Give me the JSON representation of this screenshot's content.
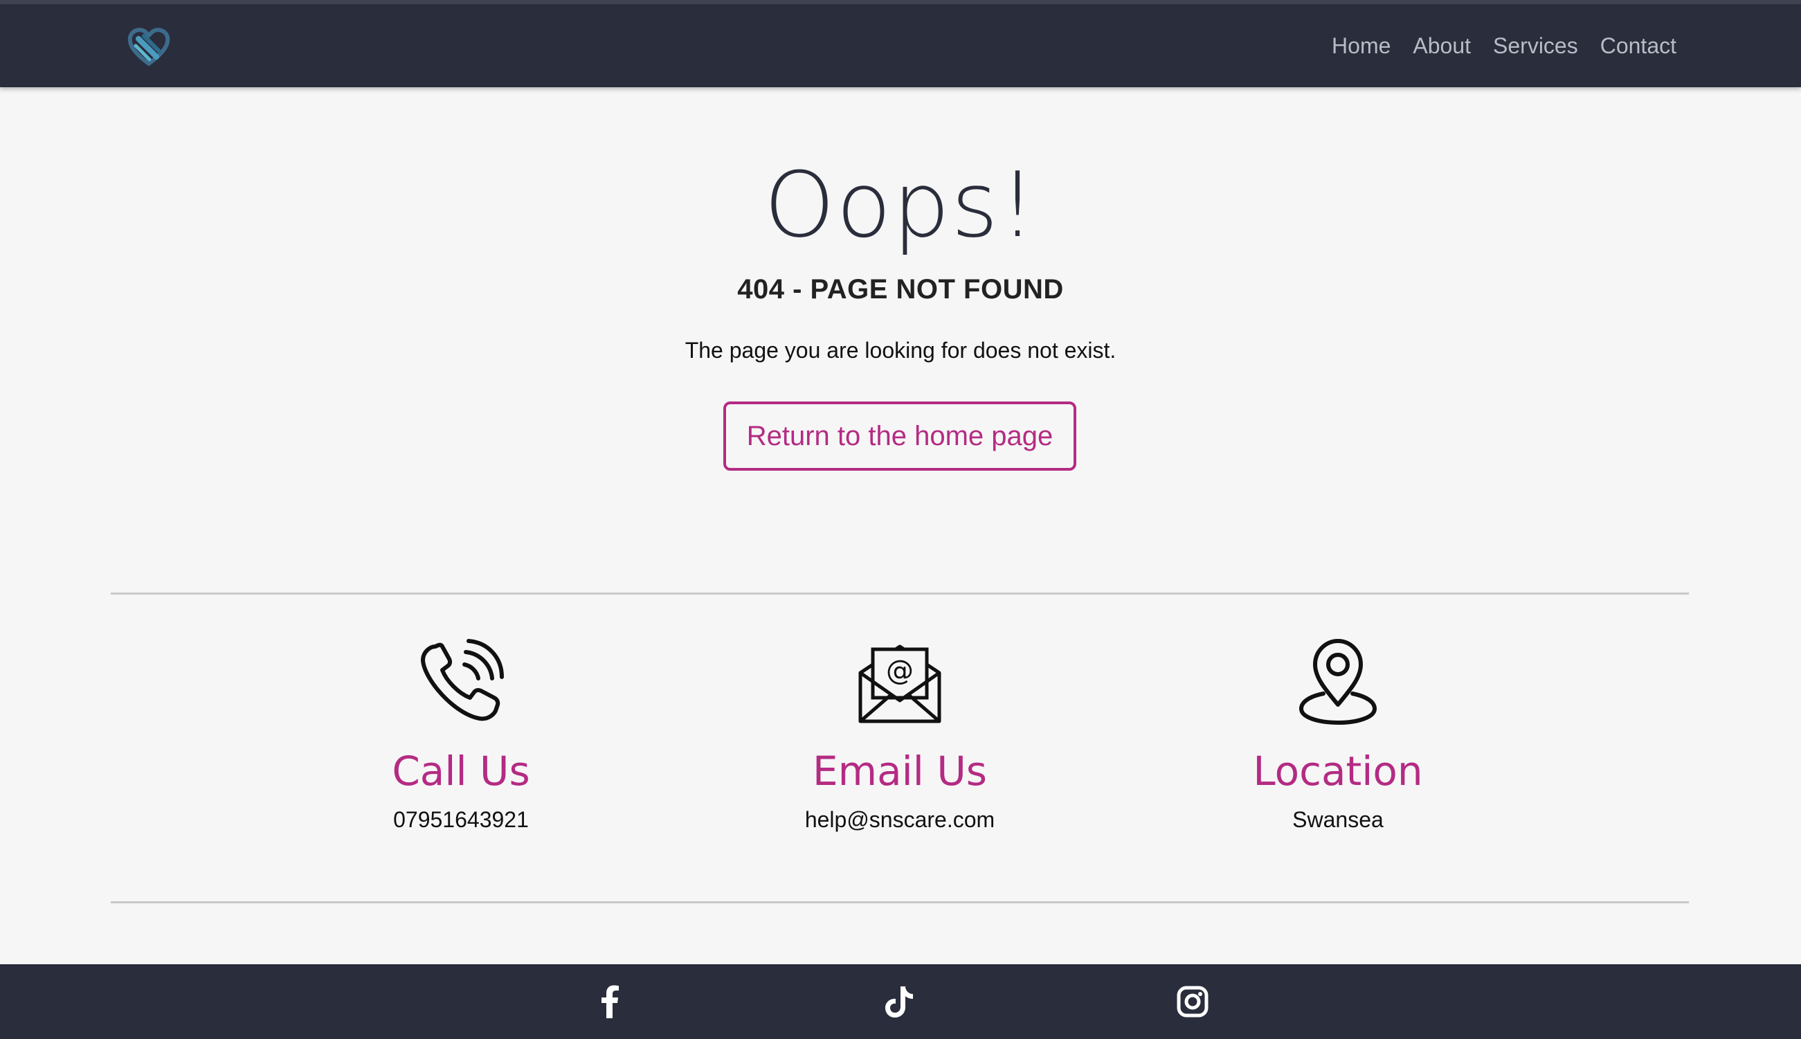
{
  "nav": {
    "logo_icon": "heart-logo-icon",
    "items": [
      {
        "label": "Home"
      },
      {
        "label": "About"
      },
      {
        "label": "Services"
      },
      {
        "label": "Contact"
      }
    ]
  },
  "hero": {
    "title": "Oops!",
    "subtitle": "404 - PAGE NOT FOUND",
    "description": "The page you are looking for does not exist.",
    "button_label": "Return to the home page"
  },
  "contact": [
    {
      "icon": "phone-icon",
      "heading": "Call Us",
      "value": "07951643921"
    },
    {
      "icon": "email-icon",
      "heading": "Email Us",
      "value": "help@snscare.com"
    },
    {
      "icon": "location-pin-icon",
      "heading": "Location",
      "value": "Swansea"
    }
  ],
  "footer": {
    "social": [
      {
        "icon": "facebook-icon"
      },
      {
        "icon": "tiktok-icon"
      },
      {
        "icon": "instagram-icon"
      }
    ]
  },
  "colors": {
    "accent": "#b42b83",
    "dark": "#2a2d3b",
    "background": "#f6f6f6"
  }
}
